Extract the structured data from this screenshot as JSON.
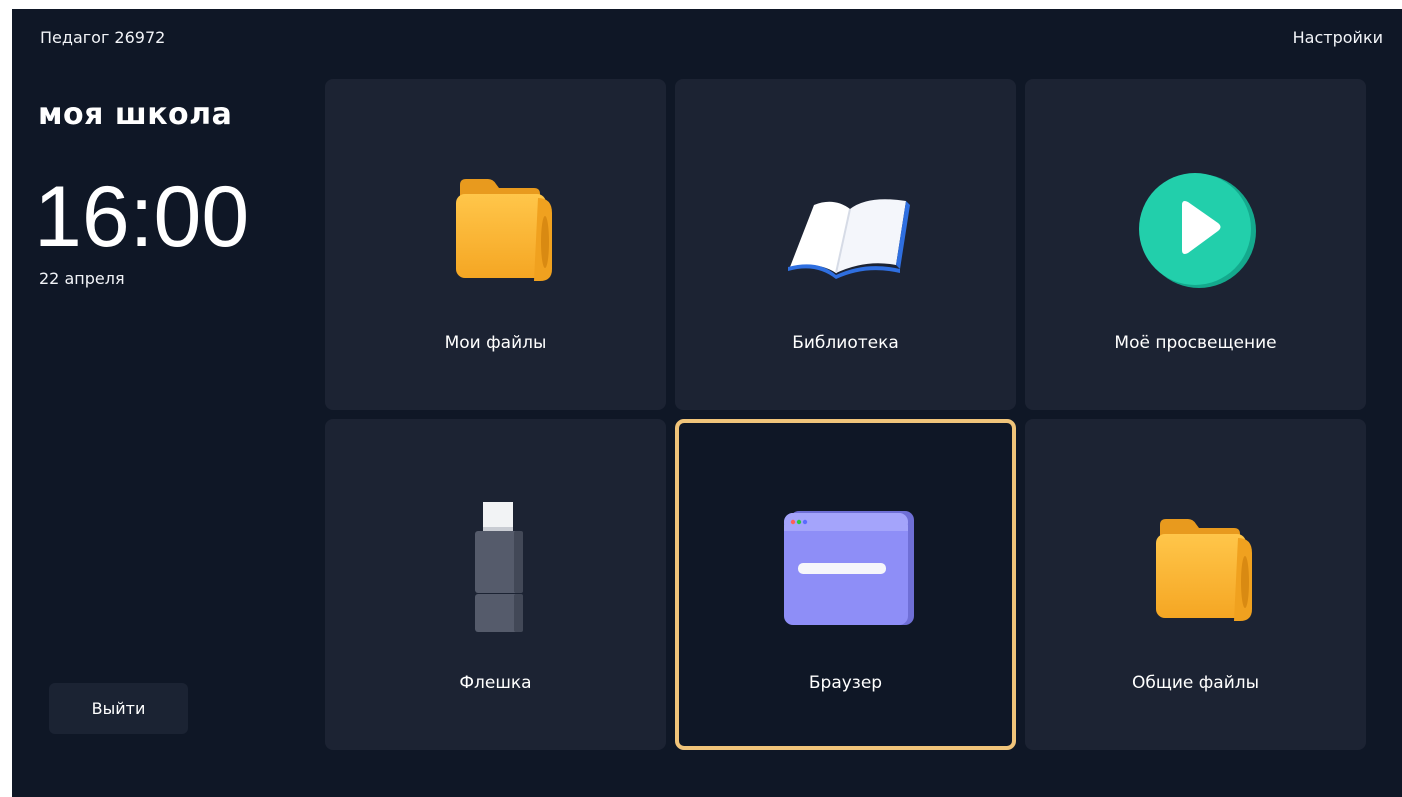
{
  "header": {
    "user_name": "Педагог 26972",
    "settings_label": "Настройки"
  },
  "sidebar": {
    "brand": "моя школа",
    "time": "16:00",
    "date": "22 апреля",
    "logout_label": "Выйти"
  },
  "tiles": [
    {
      "label": "Мои файлы",
      "icon": "folder-icon",
      "color": "#f7b63a"
    },
    {
      "label": "Библиотека",
      "icon": "book-icon",
      "color": "#2f6fe0"
    },
    {
      "label": "Моё просвещение",
      "icon": "play-icon",
      "color": "#1fc7a6"
    },
    {
      "label": "Флешка",
      "icon": "usb-flash-drive-icon",
      "color": "#4a4f5e"
    },
    {
      "label": "Браузер",
      "icon": "browser-window-icon",
      "color": "#8c8cf5",
      "selected": true
    },
    {
      "label": "Общие файлы",
      "icon": "folder-icon",
      "color": "#f7b63a"
    }
  ],
  "colors": {
    "background": "#0f1726",
    "tile": "#1c2333",
    "selection_border": "#f0c47a"
  }
}
